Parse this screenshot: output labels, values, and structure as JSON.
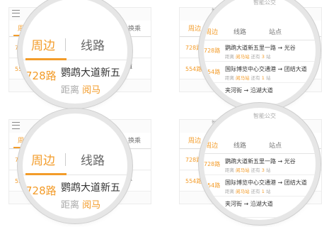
{
  "app": {
    "title": "智能公交"
  },
  "tabs": {
    "nearby": "周边",
    "lines": "线路",
    "stops": "站点",
    "transfer": "换乘"
  },
  "routes": [
    {
      "id": "728路",
      "stop": "鹦鹉大道新五里一路",
      "dest": "光谷",
      "dist_label": "距离",
      "station": "阅马站",
      "remain": "还有",
      "count": "3",
      "unit": "站"
    },
    {
      "id": "554路",
      "stop": "国际博览中心交通港",
      "dest": "团结大道",
      "dist_label": "距离",
      "station": "阅马站",
      "remain": "还有",
      "count": "1",
      "unit": "站"
    },
    {
      "id": "",
      "stop": "夹河街",
      "dest": "沿湖大道",
      "dist_label": "",
      "station": "",
      "remain": "",
      "count": "",
      "unit": ""
    }
  ],
  "lens": {
    "route": "728路",
    "stop": "鹦鹉大道新五",
    "dist": "距离",
    "station": "阅马"
  },
  "colors": {
    "accent": "#f39c2a",
    "text": "#333333",
    "muted": "#aaaaaa"
  },
  "icons": {
    "menu": "hamburger-icon",
    "chevron": "chevron-right-icon"
  }
}
